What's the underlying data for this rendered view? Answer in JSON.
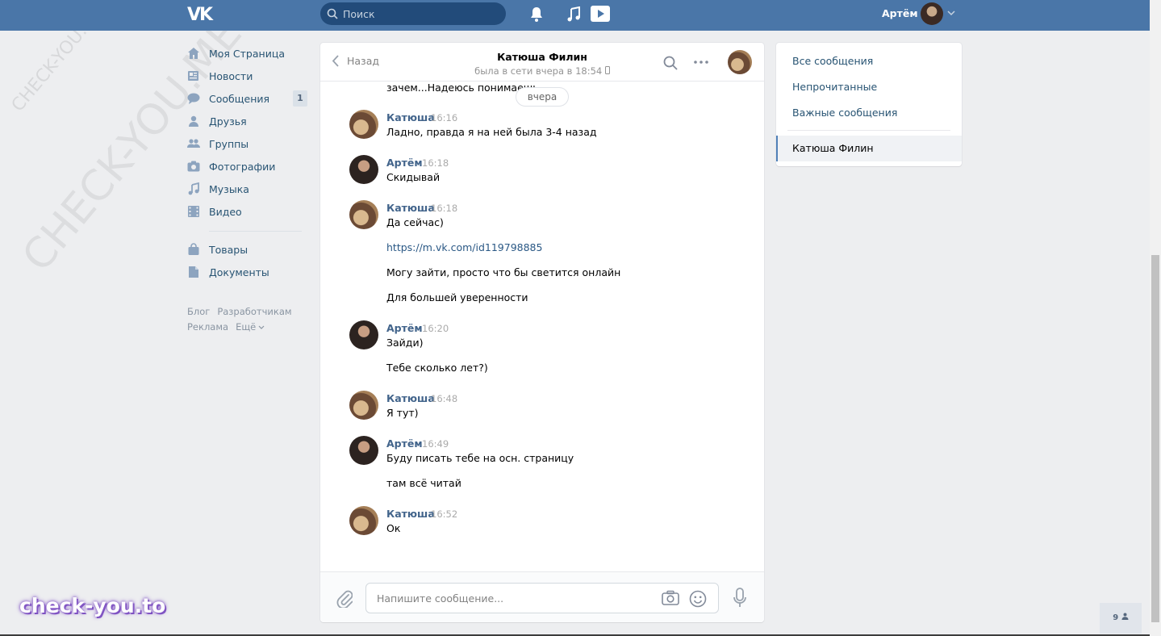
{
  "header": {
    "logo": "VK",
    "search_placeholder": "Поиск",
    "user_name": "Артём"
  },
  "sidebar": {
    "items": [
      {
        "label": "Моя Страница",
        "icon": "home-icon"
      },
      {
        "label": "Новости",
        "icon": "news-icon"
      },
      {
        "label": "Сообщения",
        "icon": "messages-icon",
        "badge": "1"
      },
      {
        "label": "Друзья",
        "icon": "friends-icon"
      },
      {
        "label": "Группы",
        "icon": "groups-icon"
      },
      {
        "label": "Фотографии",
        "icon": "photos-icon"
      },
      {
        "label": "Музыка",
        "icon": "music-icon"
      },
      {
        "label": "Видео",
        "icon": "video-icon"
      },
      {
        "label": "Товары",
        "icon": "goods-icon"
      },
      {
        "label": "Документы",
        "icon": "docs-icon"
      }
    ],
    "footer": [
      "Блог",
      "Разработчикам",
      "Реклама",
      "Ещё"
    ]
  },
  "chat": {
    "back_label": "Назад",
    "title": "Катюша Филин",
    "status": "была в сети вчера в 18:54",
    "previous_text": "зачем...Надеюсь понимаешь",
    "day_divider": "вчера",
    "messages": [
      {
        "author": "Катюша",
        "time": "16:16",
        "lines": [
          "Ладно, правда я на ней была 3-4 назад"
        ]
      },
      {
        "author": "Артём",
        "time": "16:18",
        "lines": [
          "Скидывай"
        ]
      },
      {
        "author": "Катюша",
        "time": "16:18",
        "lines": [
          "Да сейчас)",
          "https://m.vk.com/id119798885",
          "Могу зайти, просто что бы светится онлайн",
          "Для большей уверенности"
        ]
      },
      {
        "author": "Артём",
        "time": "16:20",
        "lines": [
          "Зайди)",
          "Тебе сколько лет?)"
        ]
      },
      {
        "author": "Катюша",
        "time": "16:48",
        "lines": [
          "Я тут)"
        ]
      },
      {
        "author": "Артём",
        "time": "16:49",
        "lines": [
          "Буду писать тебе на осн. страницу",
          "там всё читай"
        ]
      },
      {
        "author": "Катюша",
        "time": "16:52",
        "lines": [
          "Ок"
        ]
      }
    ],
    "input_placeholder": "Напишите сообщение..."
  },
  "filters": {
    "items": [
      "Все сообщения",
      "Непрочитанные",
      "Важные сообщения"
    ],
    "active": "Катюша Филин"
  },
  "online_count": "9",
  "watermarks": {
    "diagonal_large": "CHECK-YOU.ME",
    "diagonal_small": "CHECK-YOU.ME",
    "bottom_logo": "check-you.to"
  },
  "colors": {
    "header_bg": "#4a76a8",
    "link": "#2a5885",
    "author": "#42648b",
    "page_bg": "#edeef0"
  }
}
